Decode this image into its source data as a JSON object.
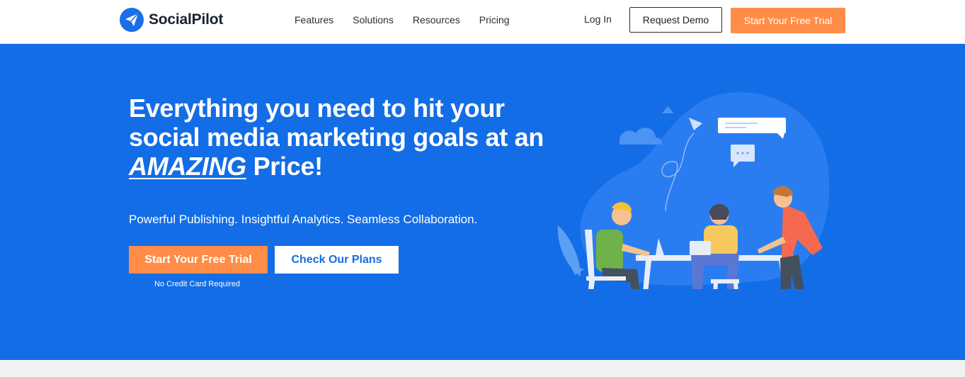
{
  "brand": {
    "name": "SocialPilot",
    "logo_icon": "paper-plane-icon",
    "color": "#1a6ee8"
  },
  "nav": {
    "items": [
      "Features",
      "Solutions",
      "Resources",
      "Pricing"
    ],
    "login": "Log In",
    "request_demo": "Request Demo",
    "start_trial": "Start Your Free Trial"
  },
  "hero": {
    "headline_line1": "Everything you need to hit your",
    "headline_line2": "social media marketing goals at an",
    "headline_emphasis": "AMAZING",
    "headline_end": " Price!",
    "subline": "Powerful Publishing. Insightful Analytics. Seamless Collaboration.",
    "primary_cta": "Start Your Free Trial",
    "secondary_cta": "Check Our Plans",
    "cta_note": "No Credit Card Required"
  },
  "colors": {
    "hero_bg": "#136de6",
    "accent": "#ff8c47",
    "page_bg": "#f2f2f2"
  }
}
